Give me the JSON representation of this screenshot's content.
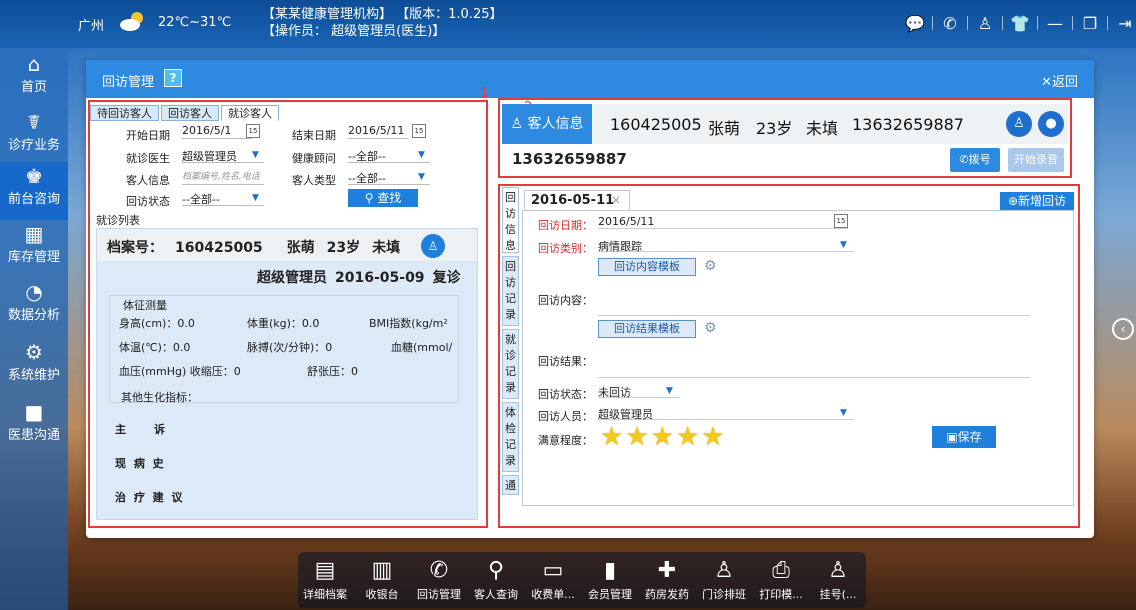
{
  "topbar": {
    "city": "广州",
    "temp": "22℃~31℃",
    "org": "【某某健康管理机构】 【版本：1.0.25】",
    "operator": "【操作员： 超级管理员(医生)】",
    "tools": [
      "message-icon",
      "phone-icon",
      "user-icon",
      "shirt-icon",
      "minimize-icon",
      "restore-icon",
      "logout-icon"
    ]
  },
  "nav": {
    "items": [
      {
        "label": "首页",
        "icon": "home-icon"
      },
      {
        "label": "诊疗业务",
        "icon": "doctor-icon"
      },
      {
        "label": "前台咨询",
        "icon": "reception-icon"
      },
      {
        "label": "库存管理",
        "icon": "store-icon"
      },
      {
        "label": "数据分析",
        "icon": "chart-icon"
      },
      {
        "label": "系统维护",
        "icon": "gear-icon"
      },
      {
        "label": "医患沟通",
        "icon": "video-icon"
      }
    ]
  },
  "window": {
    "title": "回访管理",
    "help": "?",
    "back": "返回"
  },
  "annotations": {
    "one": "1",
    "two": "2",
    "three": "3"
  },
  "panel1": {
    "tabs": [
      "待回访客人",
      "回访客人",
      "就诊客人"
    ],
    "form": {
      "start_label": "开始日期",
      "start_value": "2016/5/1",
      "end_label": "结束日期",
      "end_value": "2016/5/11",
      "doctor_label": "就诊医生",
      "doctor_value": "超级管理员",
      "advisor_label": "健康顾问",
      "advisor_value": "--全部--",
      "customer_label": "客人信息",
      "customer_placeholder": "档案编号,姓名,电话",
      "type_label": "客人类型",
      "type_value": "--全部--",
      "status_label": "回访状态",
      "status_value": "--全部--",
      "search": "查找"
    },
    "list_title": "就诊列表",
    "card": {
      "file_label": "档案号：",
      "file_no": "160425005",
      "name": "张萌",
      "age": "23岁",
      "gender": "未填",
      "visit_doctor": "超级管理员",
      "visit_date": "2016-05-09",
      "visit_type": "复诊",
      "vitals_title": "体征测量",
      "height": "身高(cm)：0.0",
      "weight": "体重(kg)：0.0",
      "bmi": "BMI指数(kg/m²",
      "temp": "体温(℃)：0.0",
      "pulse": "脉搏(次/分钟)：0",
      "sugar": "血糖(mmol/",
      "bp": "血压(mmHg) 收缩压：0",
      "diastolic": "舒张压：0",
      "other": "其他生化指标：",
      "complaint": "主　　诉",
      "history": "现 病 史",
      "advice": "治 疗 建 议"
    }
  },
  "panel2": {
    "tab": "客人信息",
    "file_no": "160425005",
    "name": "张萌",
    "age": "23岁",
    "gender": "未填",
    "phone": "13632659887",
    "phone_input": "13632659887",
    "dial": "拨号",
    "record": "开始录音"
  },
  "panel3": {
    "vtabs": [
      "回访信息",
      "回访记录",
      "就诊记录",
      "体检记录",
      "通"
    ],
    "date_tab": "2016-05-11",
    "add": "新增回访",
    "date_label": "回访日期：",
    "date_value": "2016/5/11",
    "category_label": "回访类别：",
    "category_value": "病情跟踪",
    "content_template": "回访内容模板",
    "content_label": "回访内容：",
    "result_template": "回访结果模板",
    "result_label": "回访结果：",
    "status_label": "回访状态：",
    "status_value": "未回访",
    "person_label": "回访人员：",
    "person_value": "超级管理员",
    "satisfaction_label": "满意程度：",
    "satisfaction_stars": 5,
    "save": "保存"
  },
  "dock": {
    "items": [
      {
        "label": "详细档案",
        "icon": "profile-icon"
      },
      {
        "label": "收银台",
        "icon": "cashier-icon"
      },
      {
        "label": "回访管理",
        "icon": "callback-icon"
      },
      {
        "label": "客人查询",
        "icon": "customer-search-icon"
      },
      {
        "label": "收费单...",
        "icon": "bill-icon"
      },
      {
        "label": "会员管理",
        "icon": "member-icon"
      },
      {
        "label": "药房发药",
        "icon": "pharmacy-icon"
      },
      {
        "label": "门诊排班",
        "icon": "schedule-icon"
      },
      {
        "label": "打印模...",
        "icon": "print-icon"
      },
      {
        "label": "挂号(...",
        "icon": "register-icon"
      }
    ]
  }
}
